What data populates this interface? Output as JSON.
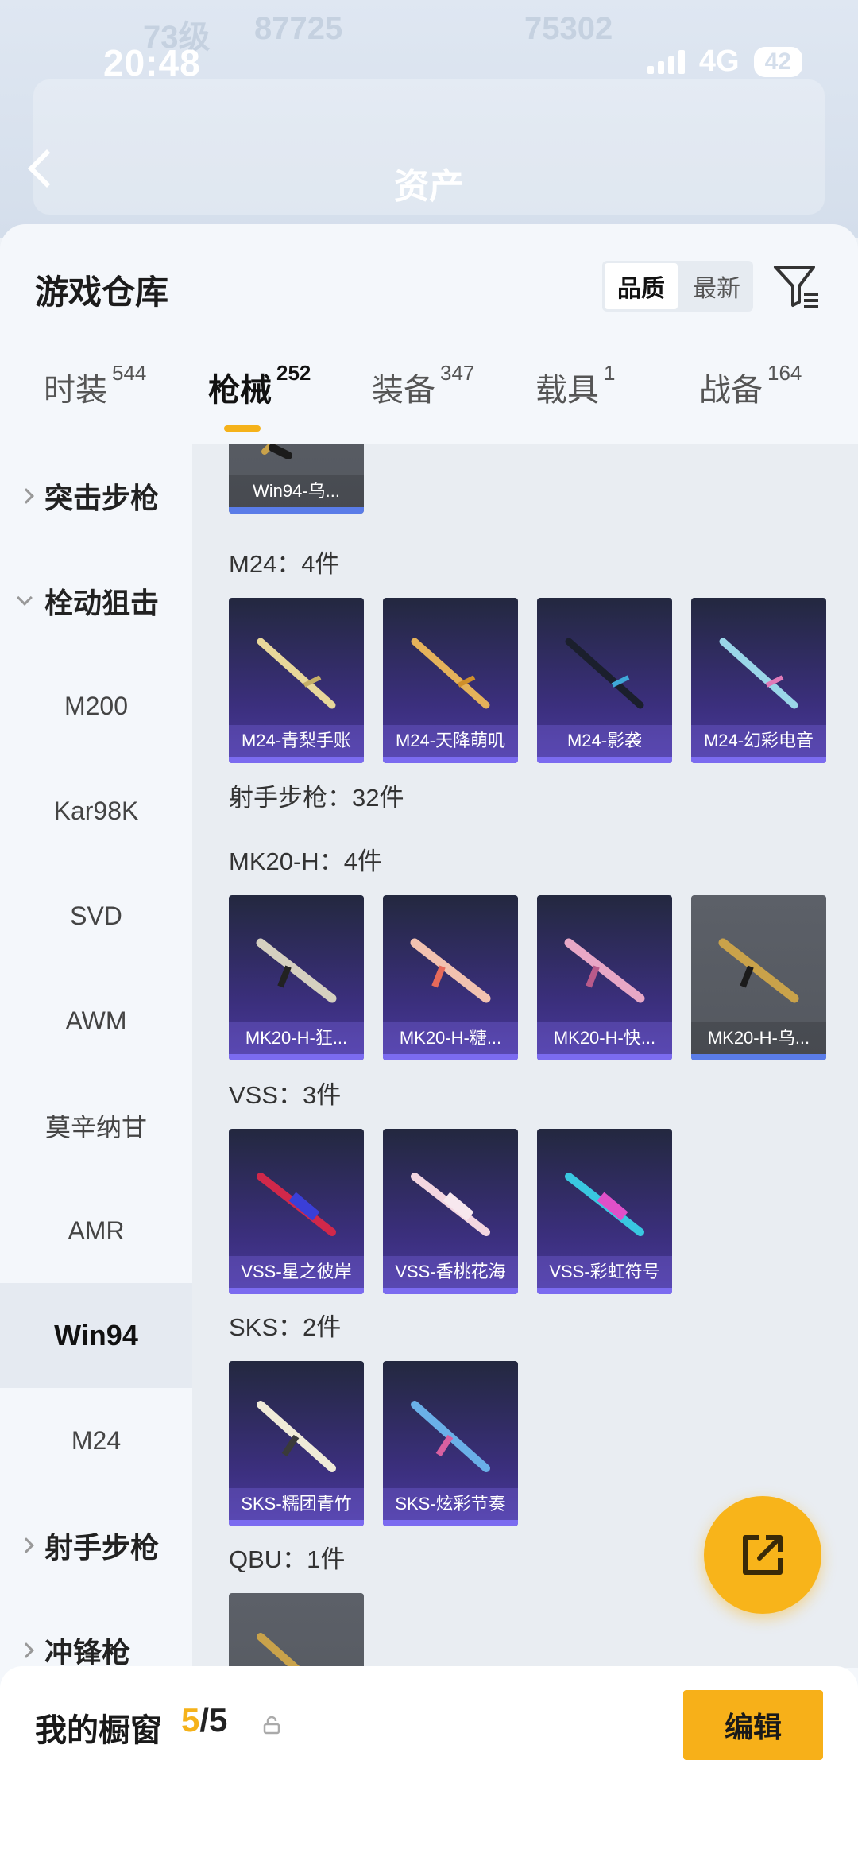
{
  "status_bar": {
    "time": "20:48",
    "network": "4G",
    "battery": "42"
  },
  "header_blur": {
    "level": "73级",
    "coins": "87725",
    "gems": "75302",
    "title": "资产"
  },
  "panel": {
    "title": "游戏仓库",
    "sort_options": [
      "品质",
      "最新"
    ],
    "sort_active": "品质"
  },
  "tabs": [
    {
      "label": "时装",
      "count": "544"
    },
    {
      "label": "枪械",
      "count": "252"
    },
    {
      "label": "装备",
      "count": "347"
    },
    {
      "label": "载具",
      "count": "1"
    },
    {
      "label": "战备",
      "count": "164"
    }
  ],
  "active_tab": "枪械",
  "sidebar": {
    "items": [
      {
        "label": "突击步枪",
        "type": "group-collapsed"
      },
      {
        "label": "栓动狙击",
        "type": "group-expanded"
      },
      {
        "label": "M200",
        "type": "item"
      },
      {
        "label": "Kar98K",
        "type": "item"
      },
      {
        "label": "SVD",
        "type": "item"
      },
      {
        "label": "AWM",
        "type": "item"
      },
      {
        "label": "莫辛纳甘",
        "type": "item"
      },
      {
        "label": "AMR",
        "type": "item"
      },
      {
        "label": "Win94",
        "type": "item-selected"
      },
      {
        "label": "M24",
        "type": "item"
      },
      {
        "label": "射手步枪",
        "type": "group-collapsed"
      },
      {
        "label": "冲锋枪",
        "type": "group-collapsed"
      }
    ]
  },
  "content": {
    "top_partial_card": "Win94-乌...",
    "sections": [
      {
        "label": "M24：4件",
        "cards": [
          "M24-青梨手账",
          "M24-天降萌叽",
          "M24-影袭",
          "M24-幻彩电音"
        ]
      },
      {
        "label": "射手步枪：32件"
      },
      {
        "label": "MK20-H：4件",
        "cards": [
          "MK20-H-狂...",
          "MK20-H-糖...",
          "MK20-H-快...",
          "MK20-H-乌..."
        ]
      },
      {
        "label": "VSS：3件",
        "cards": [
          "VSS-星之彼岸",
          "VSS-香桃花海",
          "VSS-彩虹符号"
        ]
      },
      {
        "label": "SKS：2件",
        "cards": [
          "SKS-糯团青竹",
          "SKS-炫彩节奏"
        ]
      },
      {
        "label": "QBU：1件"
      }
    ]
  },
  "fab": {
    "icon": "share-icon"
  },
  "bottom_bar": {
    "label": "我的橱窗",
    "current": "5",
    "total": "/5",
    "edit_label": "编辑"
  }
}
